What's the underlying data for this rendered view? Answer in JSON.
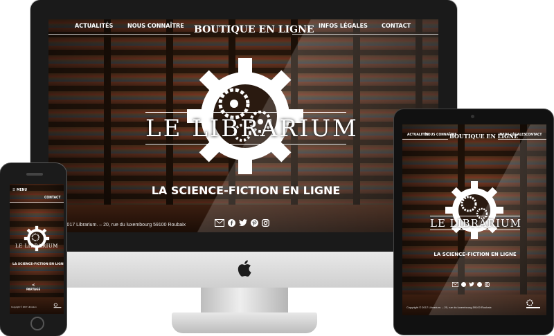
{
  "site": {
    "nav": {
      "items": [
        "ACTUALITÉS",
        "NOUS CONNAÎTRE",
        "BOUTIQUE EN LIGNE",
        "INFOS LÉGALES",
        "CONTACT"
      ],
      "active": "BOUTIQUE EN LIGNE"
    },
    "logo_text": "LE LIBRARIUM",
    "tagline": "LA SCIENCE-FICTION EN LIGNE",
    "footer": "Copyright © 2017 Librarium. – 20, rue du luxembourg 59100 Roubaix",
    "imac_footer_visible": "right © 2017 Librarium. – 20, rue du luxembourg 59100 Roubaix",
    "social_icons": [
      "mail-icon",
      "facebook-icon",
      "twitter-icon",
      "pinterest-icon",
      "instagram-icon"
    ]
  },
  "phone": {
    "menu_label": "MENU",
    "contact_label": "CONTACT",
    "share_label": "PARTAGE",
    "footer_line": "Copyright © 2017 Librarium"
  },
  "colors": {
    "background": "#ffffff",
    "device_dark": "#1a1a1a",
    "aluminum": "#d9d9d9",
    "wood": "#3b1e10",
    "text": "#ffffff"
  }
}
